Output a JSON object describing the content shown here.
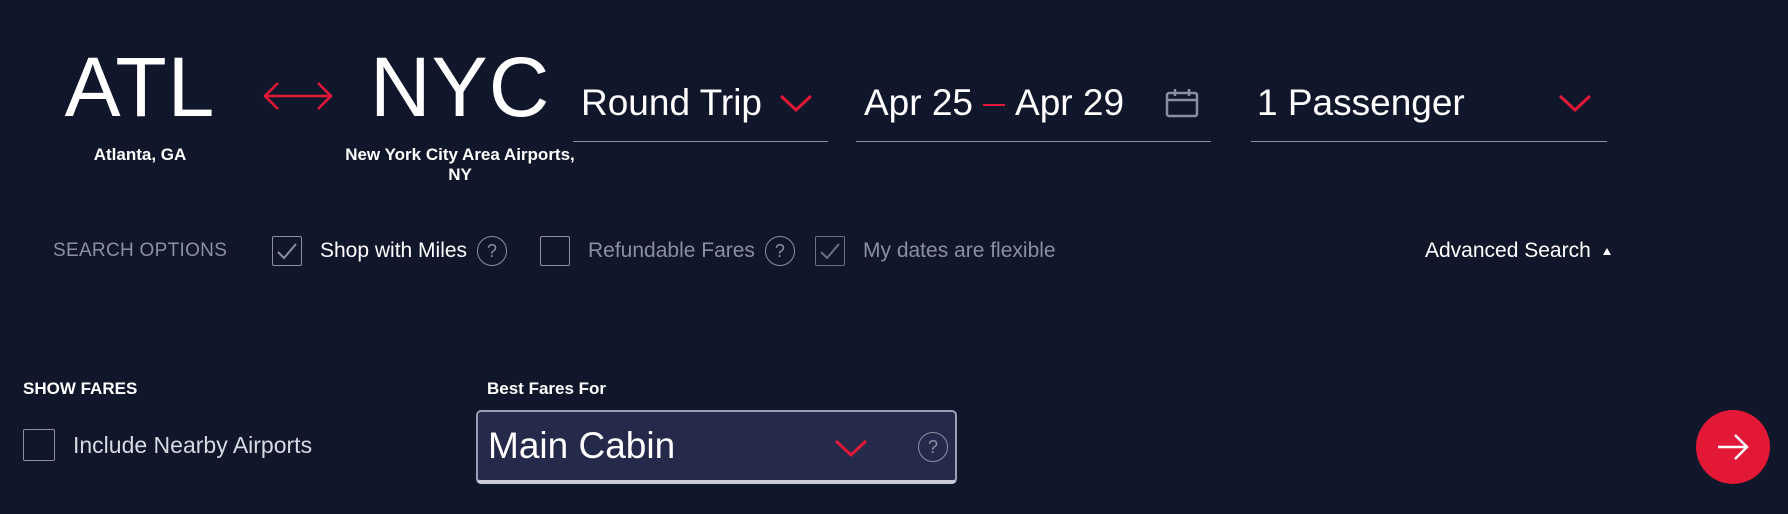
{
  "origin": {
    "code": "ATL",
    "name": "Atlanta, GA"
  },
  "destination": {
    "code": "NYC",
    "name": "New York City Area Airports, NY"
  },
  "trip_type": {
    "value": "Round Trip"
  },
  "dates": {
    "depart": "Apr 25",
    "return": "Apr 29"
  },
  "passengers": {
    "value": "1 Passenger"
  },
  "search_options": {
    "label": "SEARCH OPTIONS",
    "shop_with_miles": {
      "label": "Shop with Miles",
      "checked": true
    },
    "refundable_fares": {
      "label": "Refundable Fares",
      "checked": false
    },
    "flexible_dates": {
      "label": "My dates are flexible",
      "checked": true,
      "disabled": true
    },
    "help_glyph": "?"
  },
  "advanced_search": {
    "label": "Advanced Search"
  },
  "show_fares": {
    "label": "SHOW FARES",
    "nearby_airports": {
      "label": "Include Nearby Airports",
      "checked": false
    }
  },
  "best_fares": {
    "label": "Best Fares For",
    "value": "Main Cabin"
  },
  "colors": {
    "background": "#11172a",
    "accent": "#e31837",
    "muted": "#8a90a3",
    "select_bg": "#252a4a"
  },
  "icons": {
    "swap": "swap-arrows-icon",
    "chevron": "chevron-down-icon",
    "calendar": "calendar-icon",
    "help": "help-circle-icon",
    "check": "checkmark-icon",
    "submit": "arrow-right-icon",
    "caret": "caret-up-icon"
  }
}
